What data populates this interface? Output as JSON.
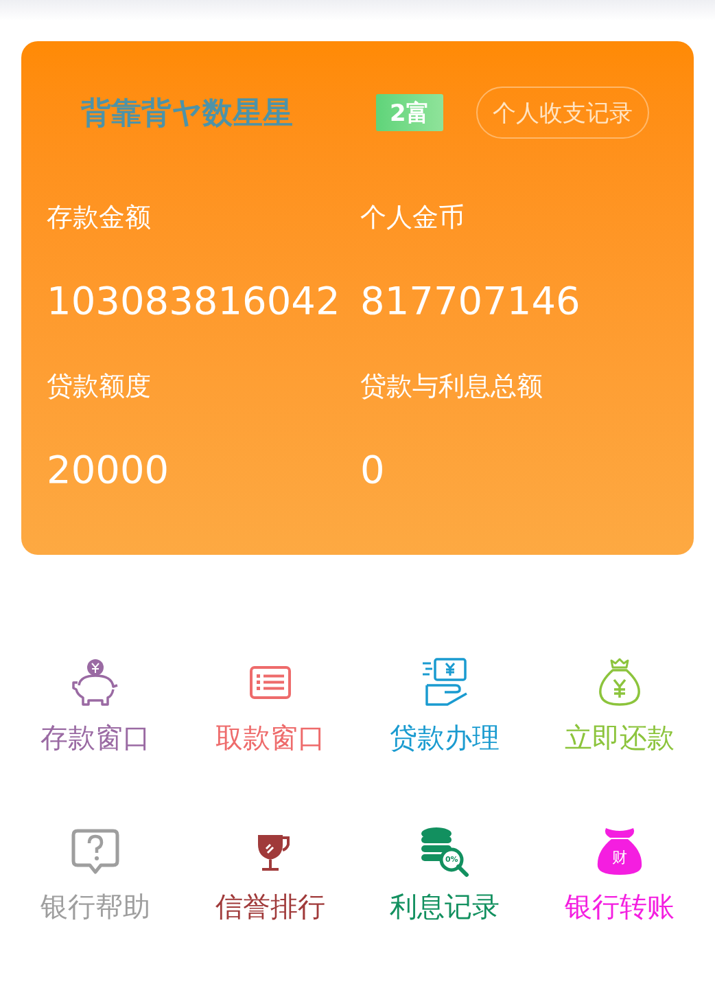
{
  "card": {
    "username": "背靠背ヤ数星星",
    "badge": "2富",
    "records_button": "个人收支记录",
    "stats": [
      {
        "label": "存款金额",
        "value": "103083816042"
      },
      {
        "label": "个人金币",
        "value": "817707146"
      },
      {
        "label": "贷款额度",
        "value": "20000"
      },
      {
        "label": "贷款与利息总额",
        "value": "0"
      }
    ]
  },
  "menu": [
    {
      "kind": "piggy",
      "label": "存款窗口",
      "color": "#9a6aa3"
    },
    {
      "kind": "list",
      "label": "取款窗口",
      "color": "#ee6b6b"
    },
    {
      "kind": "loan",
      "label": "贷款办理",
      "color": "#1a9bd0"
    },
    {
      "kind": "moneybag",
      "label": "立即还款",
      "color": "#8cc43c"
    },
    {
      "kind": "help",
      "label": "银行帮助",
      "color": "#9e9e9e"
    },
    {
      "kind": "trophy",
      "label": "信誉排行",
      "color": "#a03a3a"
    },
    {
      "kind": "coins",
      "label": "利息记录",
      "color": "#12905f",
      "icon_text": "0%"
    },
    {
      "kind": "wealthbag",
      "label": "银行转账",
      "color": "#f41ee0",
      "icon_text": "财"
    }
  ]
}
